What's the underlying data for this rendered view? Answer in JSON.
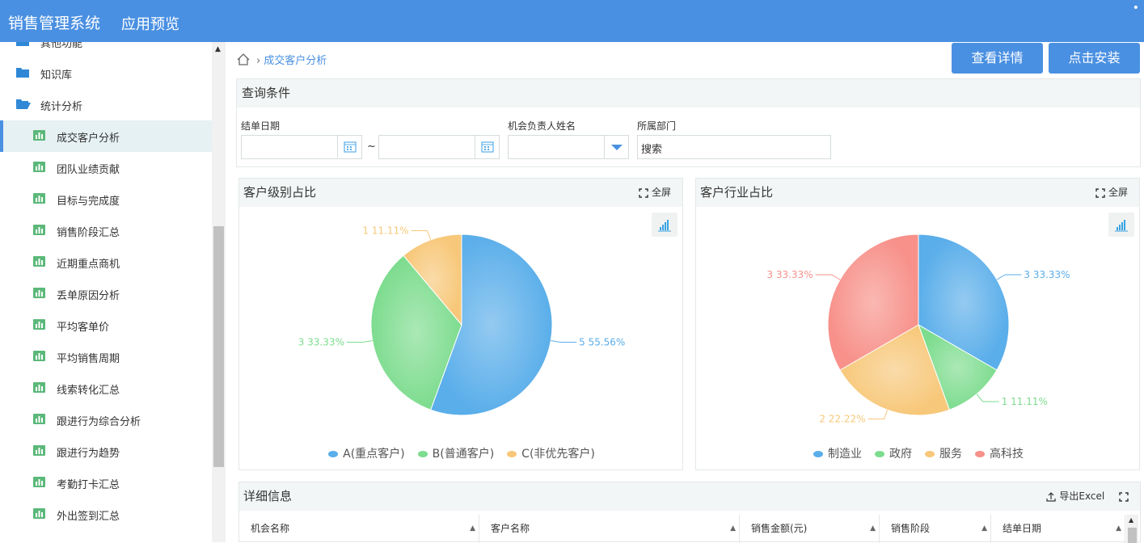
{
  "app": {
    "title": "销售管理系统",
    "subtitle": "应用预览"
  },
  "sidebar": {
    "items": [
      {
        "label": "其他功能",
        "type": "folder"
      },
      {
        "label": "知识库",
        "type": "folder"
      },
      {
        "label": "统计分析",
        "type": "folder-open"
      },
      {
        "label": "成交客户分析",
        "type": "chart",
        "active": true
      },
      {
        "label": "团队业绩贡献",
        "type": "chart"
      },
      {
        "label": "目标与完成度",
        "type": "chart"
      },
      {
        "label": "销售阶段汇总",
        "type": "chart"
      },
      {
        "label": "近期重点商机",
        "type": "chart"
      },
      {
        "label": "丢单原因分析",
        "type": "chart"
      },
      {
        "label": "平均客单价",
        "type": "chart"
      },
      {
        "label": "平均销售周期",
        "type": "chart"
      },
      {
        "label": "线索转化汇总",
        "type": "chart"
      },
      {
        "label": "跟进行为综合分析",
        "type": "chart"
      },
      {
        "label": "跟进行为趋势",
        "type": "chart"
      },
      {
        "label": "考勤打卡汇总",
        "type": "chart"
      },
      {
        "label": "外出签到汇总",
        "type": "chart"
      }
    ]
  },
  "breadcrumb": {
    "current": "成交客户分析"
  },
  "actions": {
    "details": "查看详情",
    "install": "点击安装"
  },
  "query": {
    "title": "查询条件",
    "date_label": "结单日期",
    "range_sep": "~",
    "owner_label": "机会负责人姓名",
    "dept_label": "所属部门",
    "dept_placeholder": "搜索"
  },
  "panels": {
    "fullscreen": "全屏",
    "level_title": "客户级别占比",
    "industry_title": "客户行业占比"
  },
  "chart_data": [
    {
      "type": "pie",
      "title": "客户级别占比",
      "slices": [
        {
          "name": "A(重点客户)",
          "value": 5,
          "percent": "55.56%",
          "color": "#5aaeea"
        },
        {
          "name": "B(普通客户)",
          "value": 3,
          "percent": "33.33%",
          "color": "#7ddc8e"
        },
        {
          "name": "C(非优先客户)",
          "value": 1,
          "percent": "11.11%",
          "color": "#f7c87a"
        }
      ],
      "labels": [
        "5 55.56%",
        "3 33.33%",
        "1 11.11%"
      ]
    },
    {
      "type": "pie",
      "title": "客户行业占比",
      "slices": [
        {
          "name": "制造业",
          "value": 3,
          "percent": "33.33%",
          "color": "#5aaeea"
        },
        {
          "name": "政府",
          "value": 1,
          "percent": "11.11%",
          "color": "#7ddc8e"
        },
        {
          "name": "服务",
          "value": 2,
          "percent": "22.22%",
          "color": "#f7c87a"
        },
        {
          "name": "高科技",
          "value": 3,
          "percent": "33.33%",
          "color": "#f7918a"
        }
      ],
      "labels": [
        "3 33.33%",
        "1 11.11%",
        "2 22.22%",
        "3 33.33%"
      ]
    }
  ],
  "detail": {
    "title": "详细信息",
    "export": "导出Excel",
    "columns": [
      "机会名称",
      "客户名称",
      "销售金额(元)",
      "销售阶段",
      "结单日期"
    ]
  }
}
